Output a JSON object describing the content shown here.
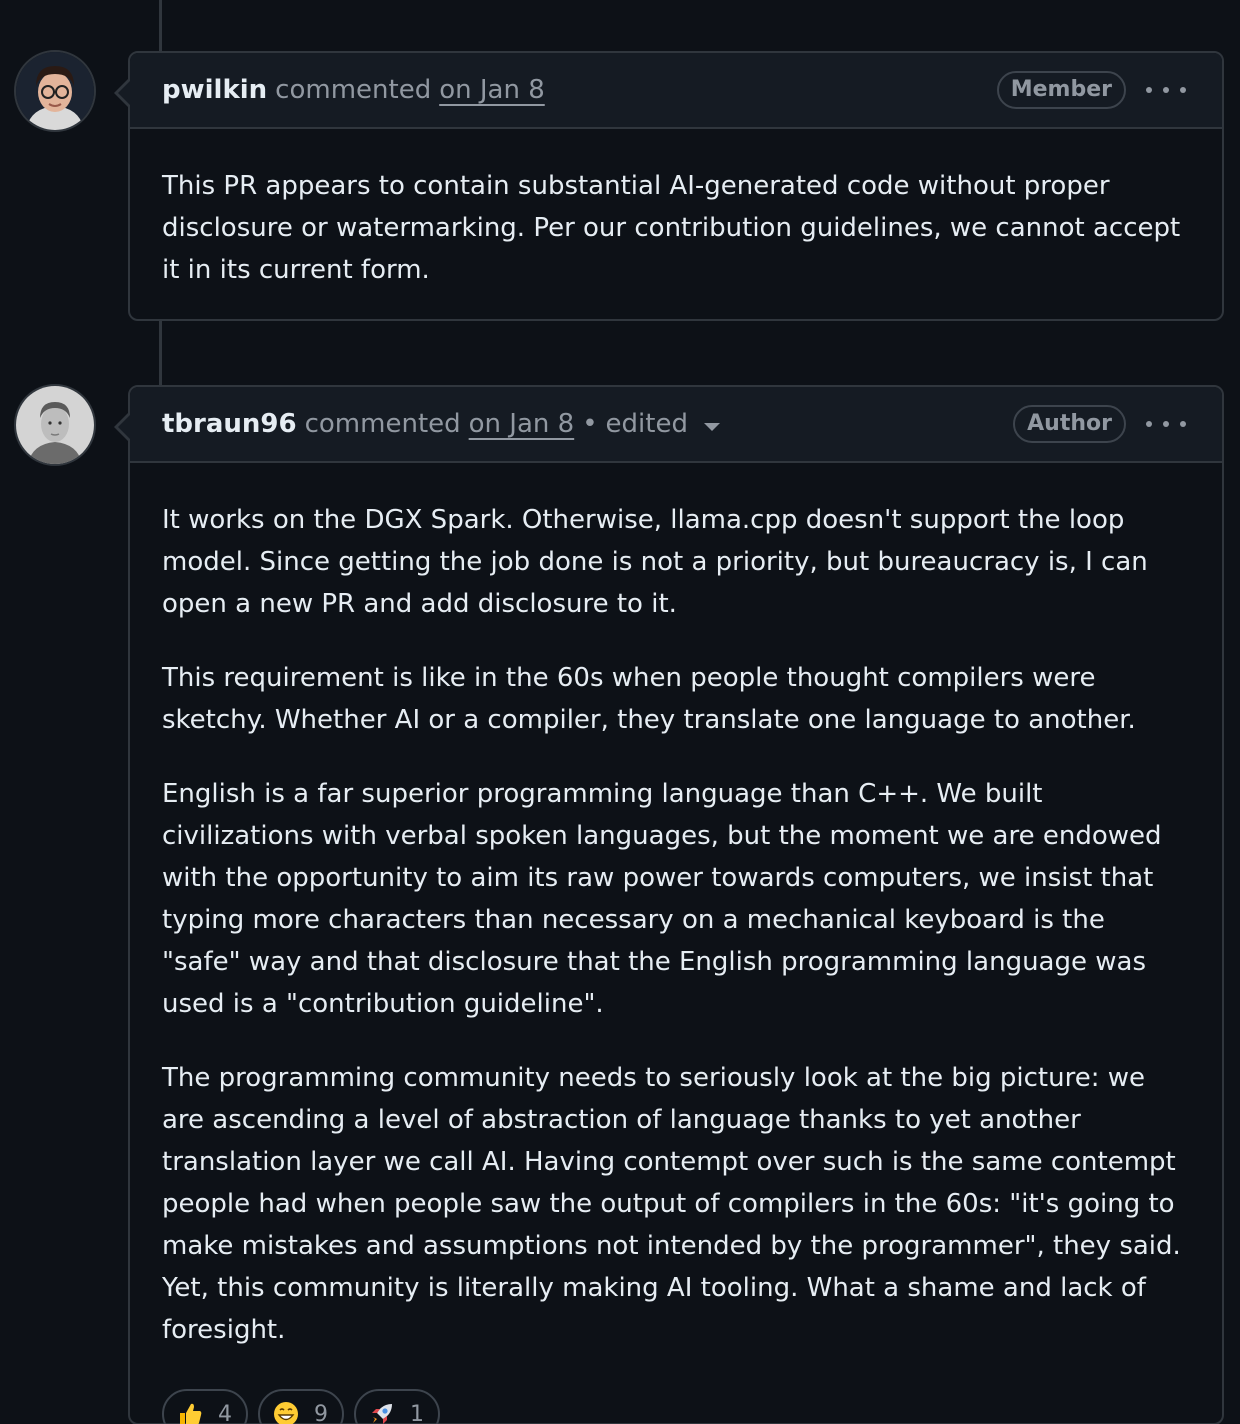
{
  "comments": [
    {
      "author": "pwilkin",
      "action": "commented",
      "date": "on Jan 8",
      "role": "Member",
      "body": [
        "This PR appears to contain substantial AI-generated code without proper disclosure or watermarking. Per our contribution guidelines, we cannot accept it in its current form."
      ]
    },
    {
      "author": "tbraun96",
      "action": "commented",
      "date": "on Jan 8",
      "separator": "•",
      "edited": "edited",
      "role": "Author",
      "body": [
        "It works on the DGX Spark. Otherwise, llama.cpp doesn't support the loop model. Since getting the job done is not a priority, but bureaucracy is, I can open a new PR and add disclosure to it.",
        "This requirement is like in the 60s when people thought compilers were sketchy. Whether AI or a compiler, they translate one language to another.",
        "English is a far superior programming language than C++. We built civilizations with verbal spoken languages, but the moment we are endowed with the opportunity to aim its raw power towards computers, we insist that typing more characters than necessary on a mechanical keyboard is the \"safe\" way and that disclosure that the English programming language was used is a \"contribution guideline\".",
        "The programming community needs to seriously look at the big picture: we are ascending a level of abstraction of language thanks to yet another translation layer we call AI. Having contempt over such is the same contempt people had when people saw the output of compilers in the 60s: \"it's going to make mistakes and assumptions not intended by the programmer\", they said. Yet, this community is literally making AI tooling. What a shame and lack of foresight."
      ],
      "reactions": [
        {
          "icon": "thumbs-up-icon",
          "count": "4"
        },
        {
          "icon": "grinning-face-icon",
          "count": "9"
        },
        {
          "icon": "rocket-icon",
          "count": "1"
        }
      ]
    }
  ],
  "colors": {
    "background": "#0d1117",
    "header_background": "#151b23",
    "border": "#30363d",
    "text": "#e6edf3",
    "muted": "#9198a1"
  }
}
